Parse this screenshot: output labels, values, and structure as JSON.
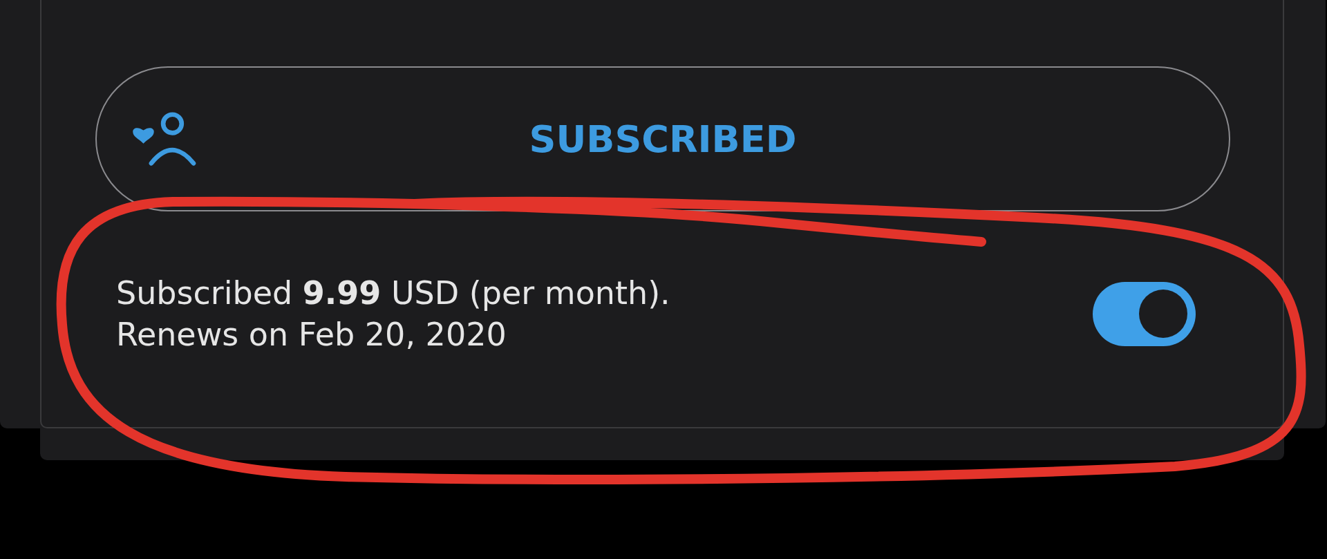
{
  "subscribe_button": {
    "label": "SUBSCRIBED",
    "selected": true
  },
  "subscription": {
    "price_line": "Subscribed **9.99** USD (per month).",
    "renewal_line": "Renews on Feb 20, 2020",
    "auto_renew": {
      "on": true
    }
  },
  "annotation": {
    "kind": "circle"
  }
}
